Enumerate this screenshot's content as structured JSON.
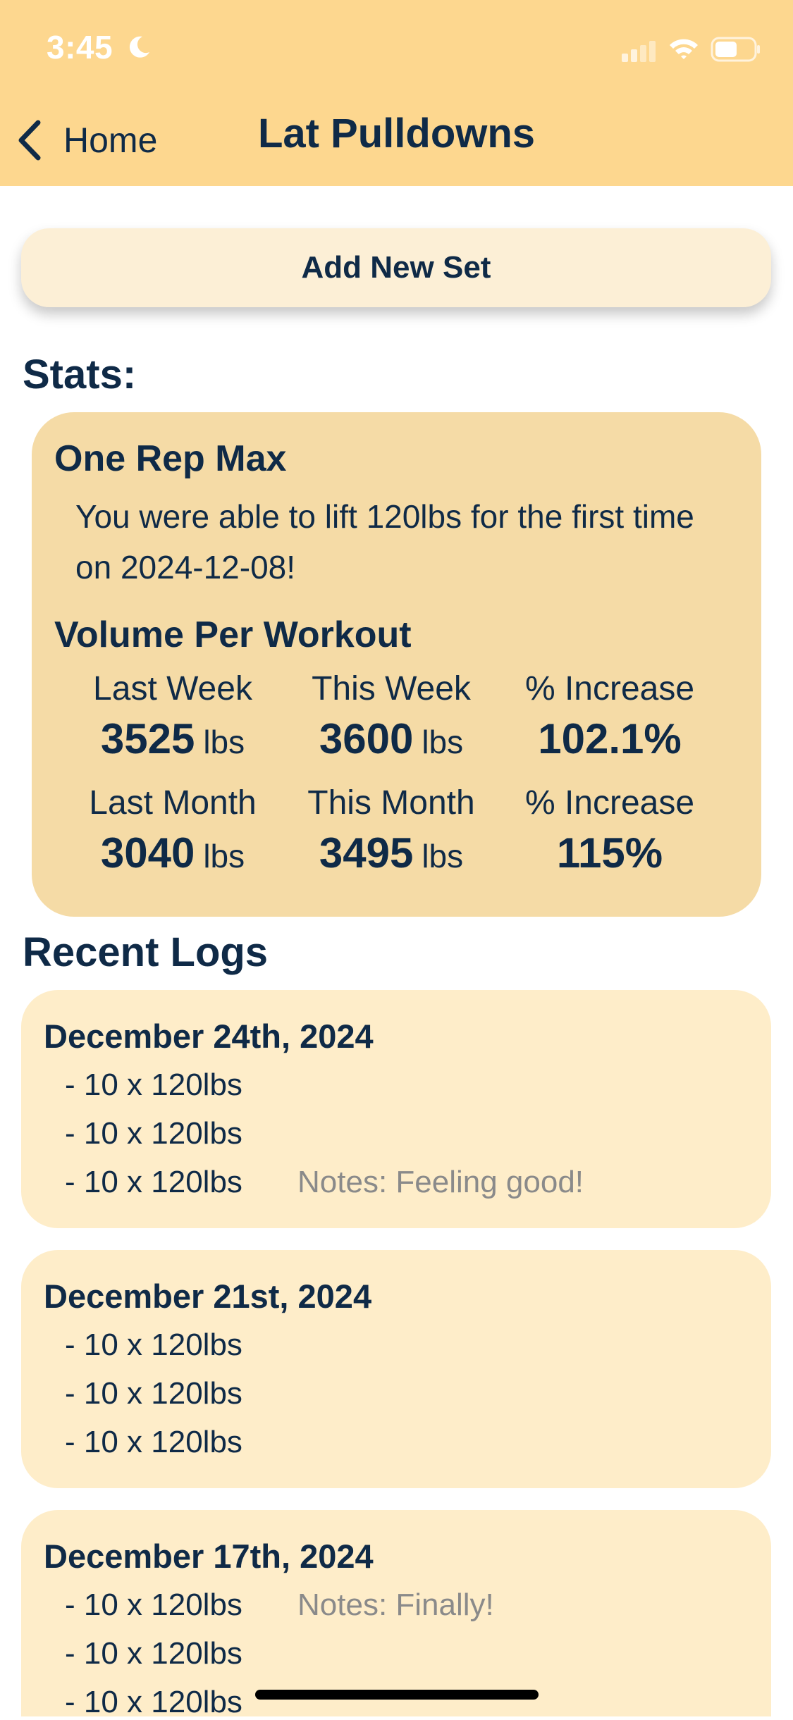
{
  "status_bar": {
    "time": "3:45"
  },
  "nav": {
    "back_label": "Home",
    "title": "Lat Pulldowns"
  },
  "add_set_label": "Add New Set",
  "stats": {
    "heading": "Stats:",
    "one_rep_max": {
      "title": "One Rep Max",
      "text": "You were able to lift 120lbs for the first time on 2024-12-08!"
    },
    "volume": {
      "title": "Volume Per Workout",
      "rows": [
        {
          "cells": [
            {
              "label": "Last Week",
              "value": "3525",
              "unit": "lbs"
            },
            {
              "label": "This Week",
              "value": "3600",
              "unit": "lbs"
            },
            {
              "label": "% Increase",
              "value": "102.1%",
              "unit": ""
            }
          ]
        },
        {
          "cells": [
            {
              "label": "Last Month",
              "value": "3040",
              "unit": "lbs"
            },
            {
              "label": "This Month",
              "value": "3495",
              "unit": "lbs"
            },
            {
              "label": "% Increase",
              "value": "115%",
              "unit": ""
            }
          ]
        }
      ]
    }
  },
  "logs": {
    "heading": "Recent Logs",
    "entries": [
      {
        "date": "December 24th, 2024",
        "sets": [
          "- 10 x 120lbs",
          "- 10 x 120lbs",
          "- 10 x 120lbs"
        ],
        "note": "Notes: Feeling good!"
      },
      {
        "date": "December 21st, 2024",
        "sets": [
          "- 10 x 120lbs",
          "- 10 x 120lbs",
          "- 10 x 120lbs"
        ],
        "note": ""
      },
      {
        "date": "December 17th, 2024",
        "sets": [
          "- 10 x 120lbs",
          "- 10 x 120lbs",
          "- 10 x 120lbs"
        ],
        "note": "Notes: Finally!"
      }
    ]
  },
  "colors": {
    "header_bg": "#fdd78f",
    "stats_card_bg": "#f5dba6",
    "log_card_bg": "#feedc9",
    "button_bg": "#fcefd6",
    "text_primary": "#0f2a47",
    "text_muted": "#8a8a8a"
  },
  "icons": [
    "moon-icon",
    "signal-icon",
    "wifi-icon",
    "battery-icon",
    "chevron-left-icon"
  ]
}
